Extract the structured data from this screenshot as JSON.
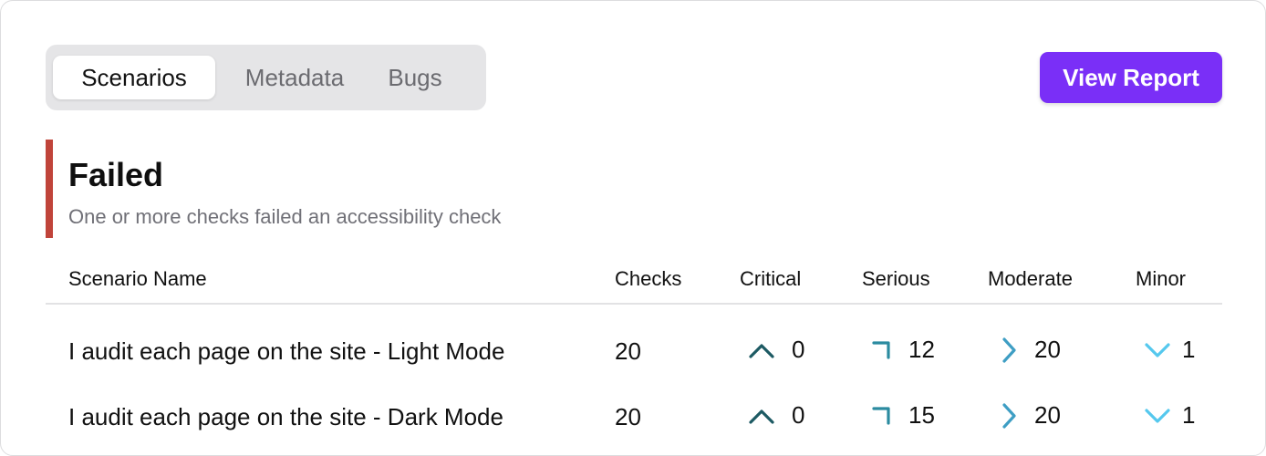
{
  "tabs": [
    {
      "label": "Scenarios",
      "active": true
    },
    {
      "label": "Metadata",
      "active": false
    },
    {
      "label": "Bugs",
      "active": false
    }
  ],
  "actions": {
    "view_report_label": "View Report",
    "accent": "#7a2ff7"
  },
  "section": {
    "title": "Failed",
    "subtitle": "One or more checks failed an accessibility check",
    "status_color": "#c0443a"
  },
  "table": {
    "columns": [
      "Scenario Name",
      "Checks",
      "Critical",
      "Serious",
      "Moderate",
      "Minor"
    ],
    "rows": [
      {
        "name": "I audit each page on the site - Light Mode",
        "checks": "20",
        "critical": "0",
        "serious": "12",
        "moderate": "20",
        "minor": "1"
      },
      {
        "name": "I audit each page on the site - Dark Mode",
        "checks": "20",
        "critical": "0",
        "serious": "15",
        "moderate": "20",
        "minor": "1"
      }
    ]
  },
  "icons": {
    "critical": "chevron-up-icon",
    "serious": "corner-arrow-icon",
    "moderate": "chevron-right-icon",
    "minor": "chevron-down-icon"
  },
  "colors": {
    "critical": "#1d5a63",
    "serious": "#2b8ba0",
    "moderate": "#3e9ec4",
    "minor": "#55c8ee"
  }
}
